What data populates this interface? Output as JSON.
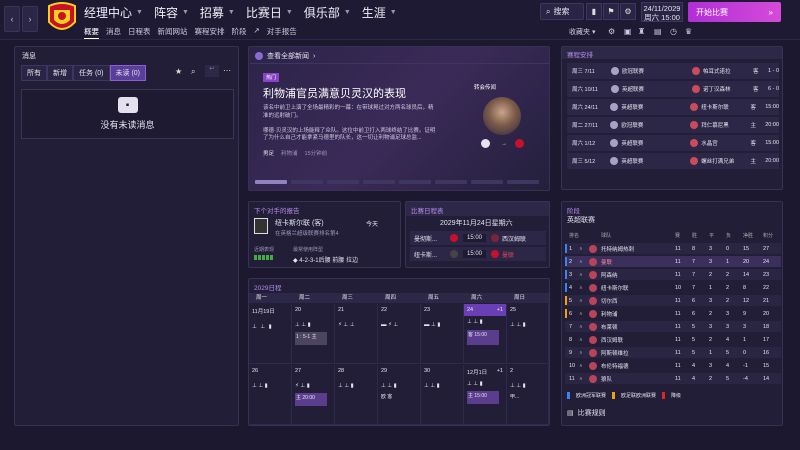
{
  "colors": {
    "accent": "#b12fd6",
    "panel": "#221e38",
    "bg": "#1b1830",
    "win": "#3fae3f",
    "highlight": "#6a3fb5"
  },
  "topbar": {
    "back_icon": "chevron-left-icon",
    "fwd_icon": "chevron-right-icon",
    "main_nav": [
      "经理中心",
      "阵容",
      "招募",
      "比赛日",
      "俱乐部",
      "生涯"
    ],
    "sub_nav": [
      "概要",
      "消息",
      "日程表",
      "新闻网站",
      "赛程安排",
      "阶段",
      "对手报告"
    ],
    "search_label": "搜索",
    "date": "24/11/2029",
    "day": "周六",
    "time": "15:00",
    "continue_label": "开始比赛",
    "inbox_label": "收藏夹"
  },
  "messages": {
    "title": "消息",
    "filters": [
      "所有",
      "新增",
      "任务 (0)",
      "未读 (0)"
    ],
    "empty_text": "没有未读消息"
  },
  "news": {
    "view_all": "查看全部新闻",
    "tag": "热门",
    "headline": "利物浦官员满意贝灵汉的表现",
    "body": "该名中前卫上演了全场最精彩的一幕：在带球晃过对方两名球员后，精准的远射破门。\n\n哪德·贝灵汉的上场能释了众队。这位中前卫打入两球终结了比赛。证明了为什么自己才能拿紧马德里的队长，这一切让利物浦足球总监...",
    "source_label": "男足",
    "source_team": "利物浦",
    "time_ago": "15分钟前",
    "side_caption": "转会传闻"
  },
  "report": {
    "title": "下个对手的报告",
    "opponent": "纽卡斯尔联 (客)",
    "when": "今天",
    "league_pos": "在英格兰超级联赛排名第4",
    "form_label": "近期表现",
    "formation_label": "最常使用阵型",
    "formation": "4-2-3-1后腰 前腰 拉边"
  },
  "match_calendar": {
    "title": "比赛日程表",
    "date": "2029年11月24日星期六",
    "rows": [
      {
        "home": "曼彻斯...",
        "time": "15:00",
        "away": "西汉姆联"
      },
      {
        "home": "纽卡斯...",
        "time": "15:00",
        "away": "曼联"
      }
    ]
  },
  "schedule": {
    "title": "2029日程",
    "weekdays": [
      "周一",
      "周二",
      "周三",
      "周四",
      "周五",
      "周六",
      "周日"
    ],
    "week1_dates": [
      "11月19日",
      "20",
      "21",
      "22",
      "23",
      "24",
      "25"
    ],
    "week2_dates": [
      "26",
      "27",
      "28",
      "29",
      "30",
      "12月1日",
      "2"
    ],
    "events": {
      "w1_tue": "1 : 5-1 主",
      "w1_sat": "客 15:00",
      "w2_tue": "主 20:00",
      "w2_thu": "欧 客",
      "w2_sat": "主 15:00",
      "w2_sun": "甲..."
    },
    "plus": "+1"
  },
  "fixtures": {
    "title": "赛程安排",
    "rows": [
      {
        "date": "周三 7/11",
        "comp": "欧冠联赛",
        "opp": "帕耳式诺拉",
        "ha": "客",
        "res": "1 - 0"
      },
      {
        "date": "周六 10/11",
        "comp": "英超联赛",
        "opp": "诺丁汉森林",
        "ha": "客",
        "res": "6 - 0"
      },
      {
        "date": "周六 24/11",
        "comp": "英超联赛",
        "opp": "纽卡斯尔联",
        "ha": "客",
        "res": "15:00"
      },
      {
        "date": "周二 27/11",
        "comp": "欧冠联赛",
        "opp": "拜仁慕尼黑",
        "ha": "主",
        "res": "20:00"
      },
      {
        "date": "周六 1/12",
        "comp": "英超联赛",
        "opp": "水晶宫",
        "ha": "客",
        "res": "15:00"
      },
      {
        "date": "周三 5/12",
        "comp": "英超联赛",
        "opp": "螺丝打满兄弟",
        "ha": "主",
        "res": "20:00"
      }
    ]
  },
  "standings": {
    "title": "阶段",
    "league": "英超联赛",
    "headers": [
      "排名",
      "",
      "球队",
      "赛",
      "胜",
      "平",
      "负",
      "净胜",
      "积分"
    ],
    "rows": [
      {
        "pos": "1",
        "team": "托特纳姆热刺",
        "p": "11",
        "w": "8",
        "d": "3",
        "l": "0",
        "gd": "15",
        "pts": "27"
      },
      {
        "pos": "2",
        "team": "曼联",
        "p": "11",
        "w": "7",
        "d": "3",
        "l": "1",
        "gd": "20",
        "pts": "24"
      },
      {
        "pos": "3",
        "team": "阿森纳",
        "p": "11",
        "w": "7",
        "d": "2",
        "l": "2",
        "gd": "14",
        "pts": "23"
      },
      {
        "pos": "4",
        "team": "纽卡斯尔联",
        "p": "10",
        "w": "7",
        "d": "1",
        "l": "2",
        "gd": "8",
        "pts": "22"
      },
      {
        "pos": "5",
        "team": "切尔西",
        "p": "11",
        "w": "6",
        "d": "3",
        "l": "2",
        "gd": "12",
        "pts": "21"
      },
      {
        "pos": "6",
        "team": "利物浦",
        "p": "11",
        "w": "6",
        "d": "2",
        "l": "3",
        "gd": "9",
        "pts": "20"
      },
      {
        "pos": "7",
        "team": "布莱顿",
        "p": "11",
        "w": "5",
        "d": "3",
        "l": "3",
        "gd": "3",
        "pts": "18"
      },
      {
        "pos": "8",
        "team": "西汉姆联",
        "p": "11",
        "w": "5",
        "d": "2",
        "l": "4",
        "gd": "1",
        "pts": "17"
      },
      {
        "pos": "9",
        "team": "阿斯顿维拉",
        "p": "11",
        "w": "5",
        "d": "1",
        "l": "5",
        "gd": "0",
        "pts": "16"
      },
      {
        "pos": "10",
        "team": "布伦特福德",
        "p": "11",
        "w": "4",
        "d": "3",
        "l": "4",
        "gd": "-1",
        "pts": "15"
      },
      {
        "pos": "11",
        "team": "狼队",
        "p": "11",
        "w": "4",
        "d": "2",
        "l": "5",
        "gd": "-4",
        "pts": "14"
      }
    ],
    "legend_ucl": "欧洲冠军联赛",
    "legend_uel": "欧足联欧洲联赛",
    "legend_rel": "降级",
    "rules_label": "比赛规则"
  }
}
